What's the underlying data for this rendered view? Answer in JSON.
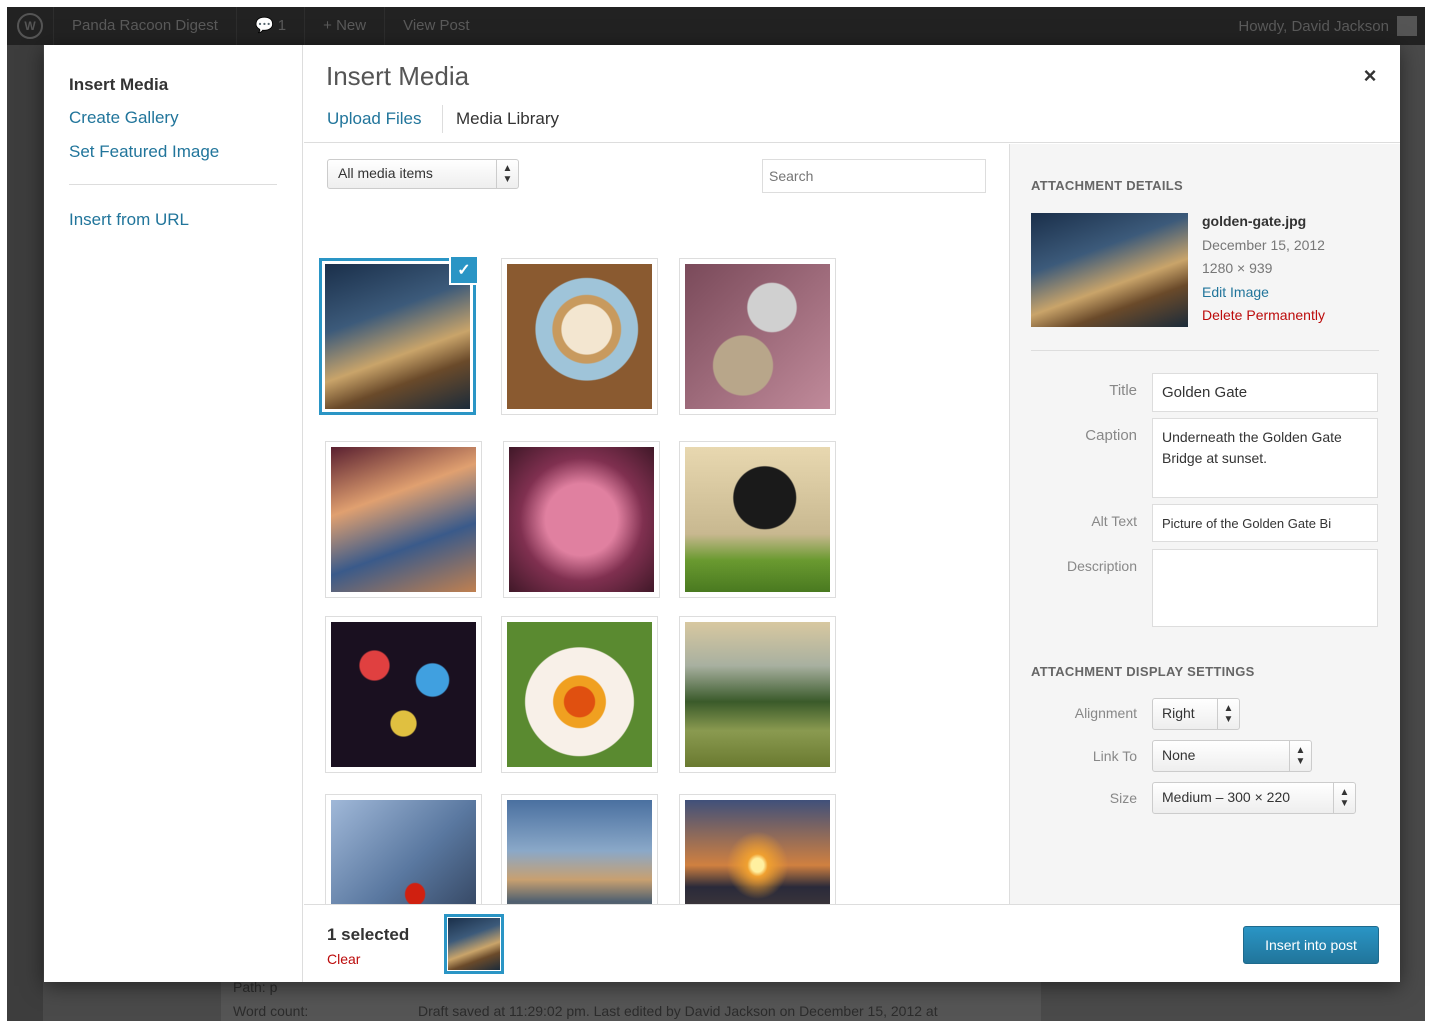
{
  "adminbar": {
    "site_name": "Panda Racoon Digest",
    "comments": "1",
    "new_label": "New",
    "view_post": "View Post",
    "howdy": "Howdy, David Jackson"
  },
  "background": {
    "path": "Path: p",
    "word_count_label": "Word count:",
    "draft_status": "Draft saved at 11:29:02 pm. Last edited by David Jackson on December 15, 2012 at"
  },
  "menu": {
    "title": "Insert Media",
    "items": [
      {
        "label": "Create Gallery"
      },
      {
        "label": "Set Featured Image"
      },
      {
        "label": "Insert from URL"
      }
    ]
  },
  "frame": {
    "title": "Insert Media",
    "close_symbol": "×",
    "tabs": [
      {
        "label": "Upload Files"
      },
      {
        "label": "Media Library"
      }
    ]
  },
  "browser": {
    "filter_value": "All media items",
    "search_placeholder": "Search",
    "attachments": [
      {
        "name": "golden-gate",
        "selected": true
      },
      {
        "name": "coffee",
        "selected": false
      },
      {
        "name": "coins",
        "selected": false
      },
      {
        "name": "dolls",
        "selected": false
      },
      {
        "name": "pig",
        "selected": false
      },
      {
        "name": "cat",
        "selected": false
      },
      {
        "name": "lights",
        "selected": false
      },
      {
        "name": "orchid",
        "selected": false
      },
      {
        "name": "hills",
        "selected": false
      },
      {
        "name": "fridge",
        "selected": false
      },
      {
        "name": "beach",
        "selected": false
      },
      {
        "name": "sunset",
        "selected": false
      }
    ],
    "check_symbol": "✓"
  },
  "details": {
    "heading": "Attachment Details",
    "filename": "golden-gate.jpg",
    "date": "December 15, 2012",
    "dimensions": "1280 × 939",
    "edit_link": "Edit Image",
    "delete_link": "Delete Permanently",
    "fields": {
      "title_label": "Title",
      "title_value": "Golden Gate",
      "caption_label": "Caption",
      "caption_value": "Underneath the Golden Gate Bridge at sunset.",
      "alt_label": "Alt Text",
      "alt_value": "Picture of the Golden Gate Bi",
      "description_label": "Description",
      "description_value": ""
    }
  },
  "display_settings": {
    "heading": "Attachment Display Settings",
    "alignment_label": "Alignment",
    "alignment_value": "Right",
    "link_label": "Link To",
    "link_value": "None",
    "size_label": "Size",
    "size_value": "Medium – 300 × 220"
  },
  "toolbar": {
    "selected_count": "1 selected",
    "clear_label": "Clear",
    "insert_label": "Insert into post"
  },
  "colors": {
    "accent": "#2a95c5",
    "link": "#21759b",
    "danger": "#bc0b0b"
  }
}
